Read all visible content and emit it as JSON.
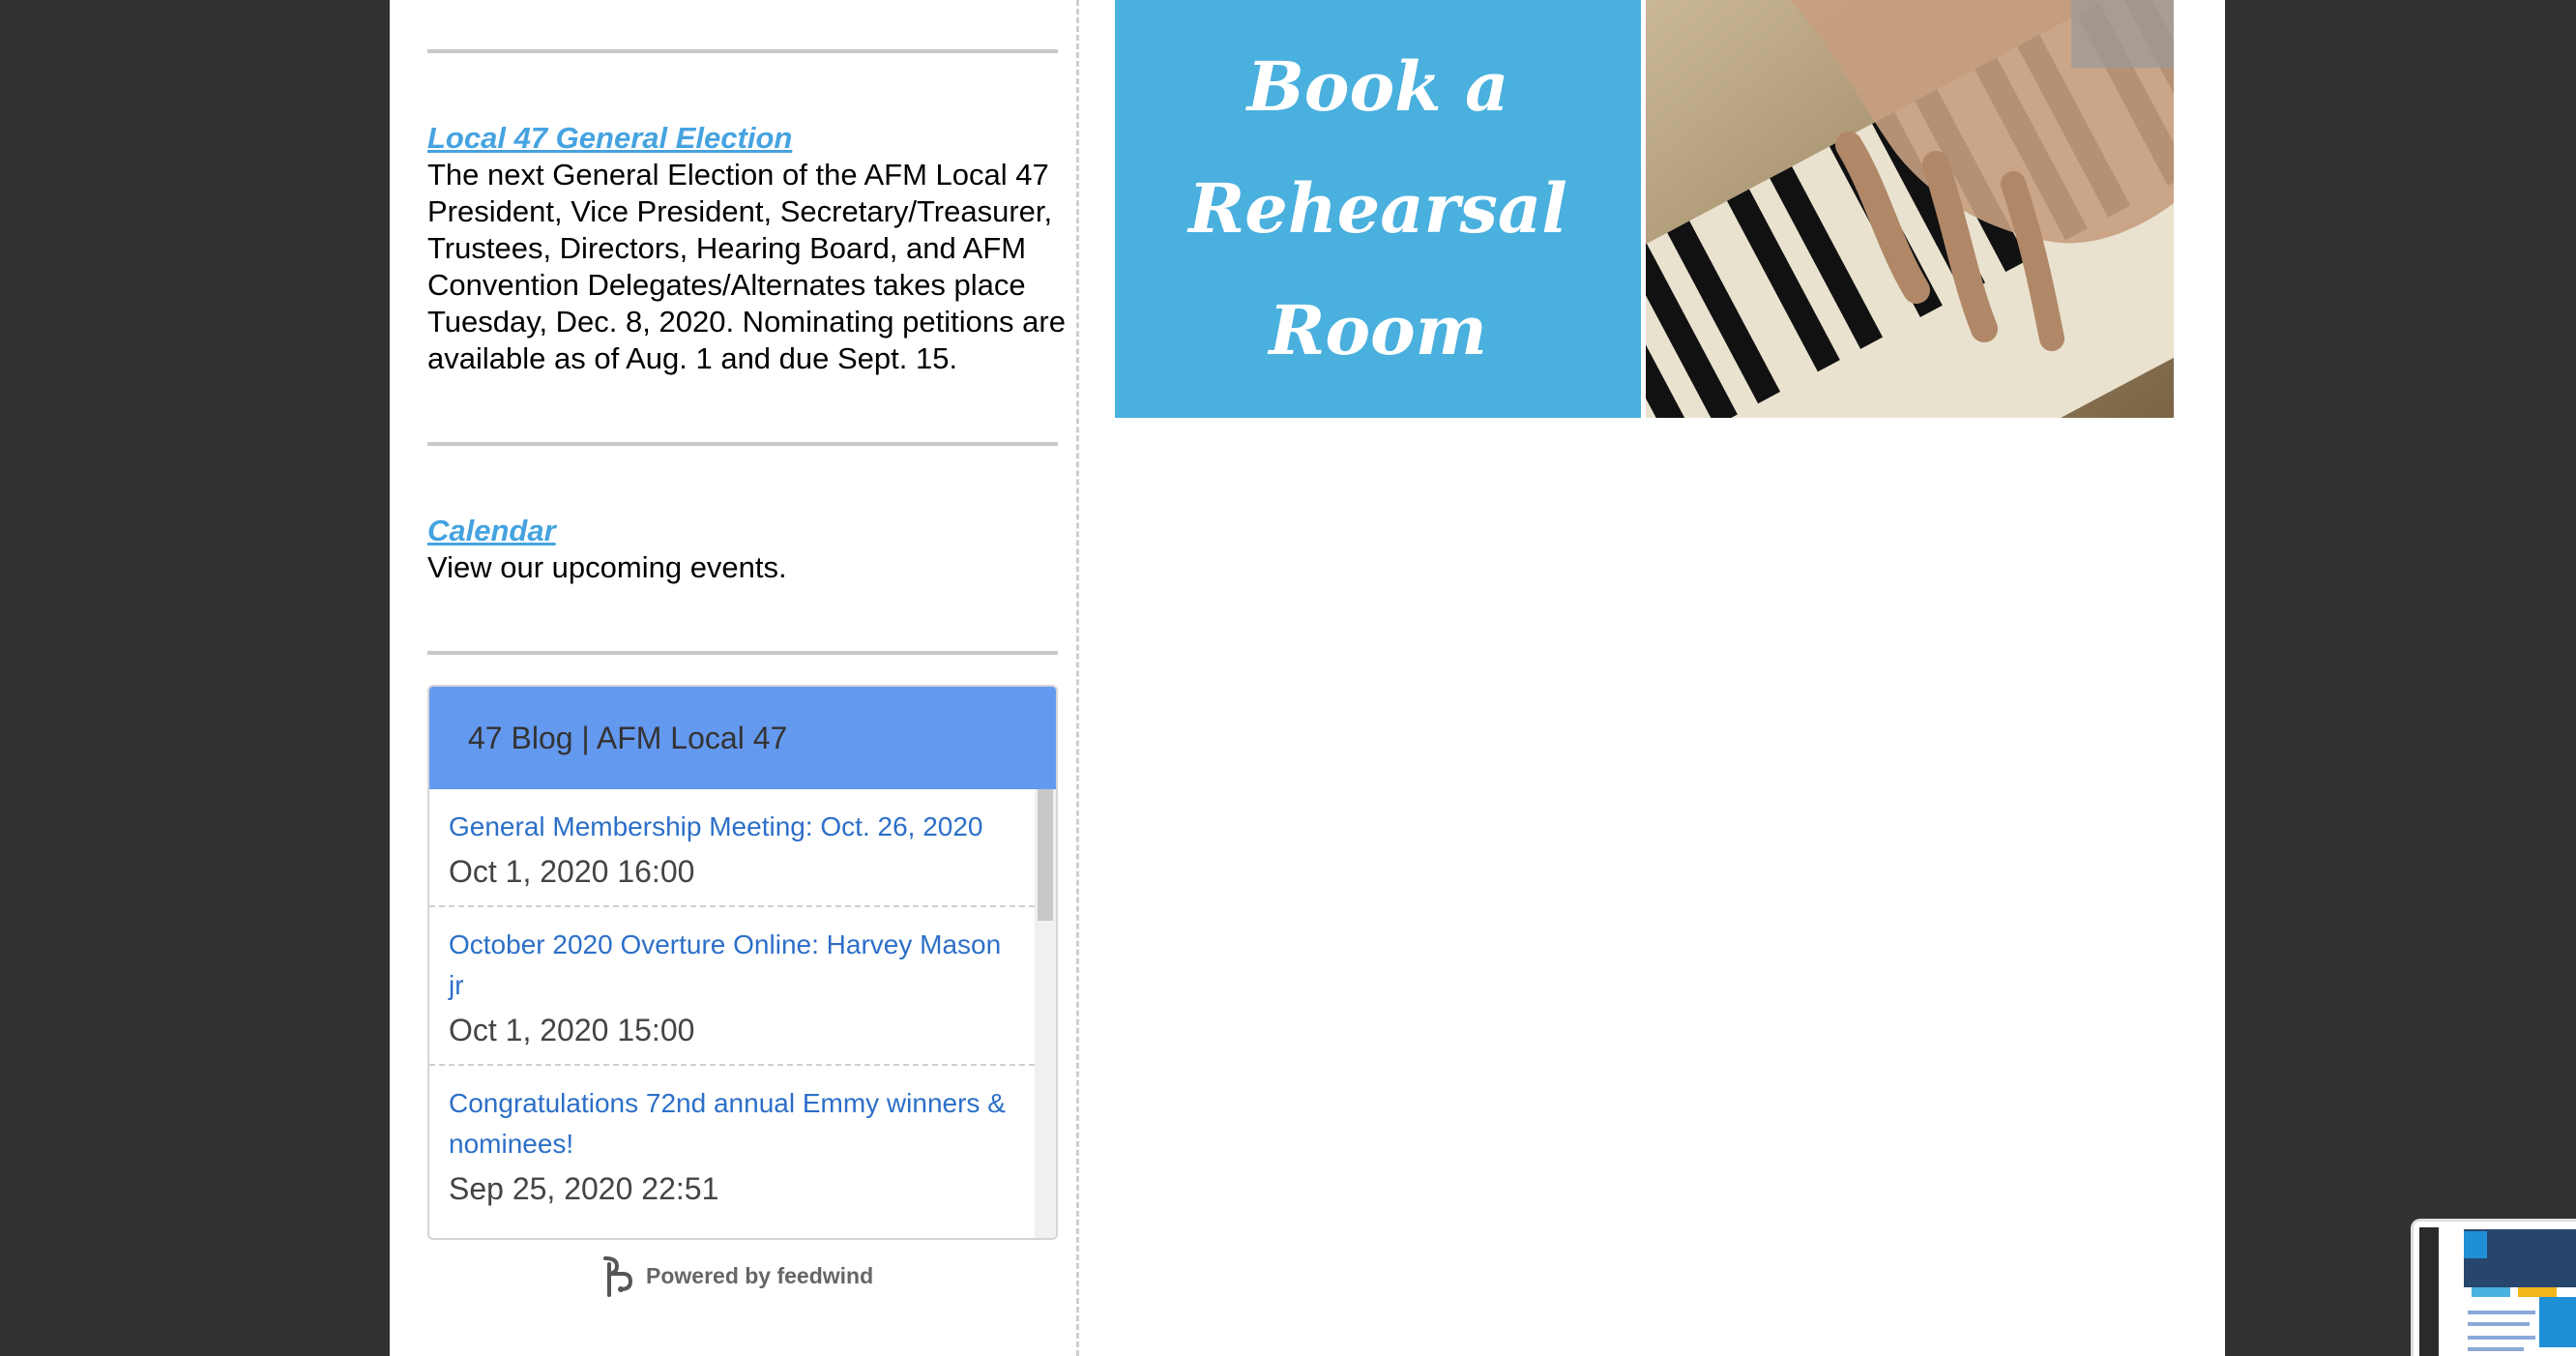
{
  "sections": [
    {
      "title": "Local 47 General Election",
      "body": "The next General Election of the AFM Local 47 President, Vice President, Secretary/Treasurer, Trustees, Directors, Hearing Board, and AFM Convention Delegates/Alternates takes place Tuesday, Dec. 8, 2020. Nominating petitions are available as of Aug. 1 and due Sept. 15."
    },
    {
      "title": "Calendar",
      "body": "View our upcoming events."
    }
  ],
  "feed": {
    "header": "47 Blog | AFM Local 47",
    "items": [
      {
        "title": "General Membership Meeting: Oct. 26, 2020",
        "date": "Oct 1, 2020 16:00"
      },
      {
        "title": "October 2020 Overture Online: Harvey Mason jr",
        "date": "Oct 1, 2020 15:00"
      },
      {
        "title": "Congratulations 72nd annual Emmy winners & nominees!",
        "date": "Sep 25, 2020 22:51"
      }
    ],
    "powered_by": "Powered by feedwind"
  },
  "banner": {
    "lines": [
      "Book a",
      "Rehearsal",
      "Room"
    ]
  },
  "colors": {
    "link": "#45a3e0",
    "feed_header": "#6499f0",
    "banner_blue": "#4ab0de",
    "background": "#323232"
  }
}
